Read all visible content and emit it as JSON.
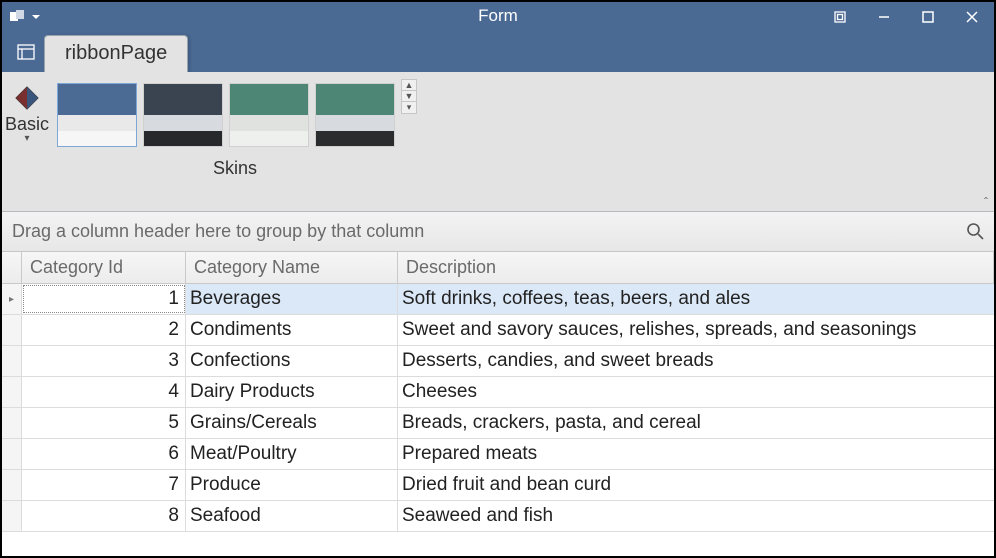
{
  "window": {
    "title": "Form"
  },
  "ribbon": {
    "tab_label": "ribbonPage",
    "basic_label": "Basic",
    "skins_label": "Skins",
    "swatches": [
      {
        "bands": [
          "#4b6b95",
          "#4b6b95",
          "#e9e9e9",
          "#f6f6f6"
        ],
        "selected": true
      },
      {
        "bands": [
          "#3a4350",
          "#3a4350",
          "#d7dadf",
          "#26282b"
        ],
        "selected": false
      },
      {
        "bands": [
          "#4e8675",
          "#4e8675",
          "#dfe2df",
          "#eef0ee"
        ],
        "selected": false
      },
      {
        "bands": [
          "#4e8675",
          "#4e8675",
          "#d7dadf",
          "#2a2c2e"
        ],
        "selected": false
      }
    ]
  },
  "group_panel": {
    "hint": "Drag a column header here to group by that column"
  },
  "grid": {
    "columns": {
      "id": "Category Id",
      "name": "Category Name",
      "desc": "Description"
    },
    "rows": [
      {
        "id": "1",
        "name": "Beverages",
        "desc": "Soft drinks, coffees, teas, beers, and ales",
        "focused": true
      },
      {
        "id": "2",
        "name": "Condiments",
        "desc": "Sweet and savory sauces, relishes, spreads, and seasonings"
      },
      {
        "id": "3",
        "name": "Confections",
        "desc": "Desserts, candies, and sweet breads"
      },
      {
        "id": "4",
        "name": "Dairy Products",
        "desc": "Cheeses"
      },
      {
        "id": "5",
        "name": "Grains/Cereals",
        "desc": "Breads, crackers, pasta, and cereal"
      },
      {
        "id": "6",
        "name": "Meat/Poultry",
        "desc": "Prepared meats"
      },
      {
        "id": "7",
        "name": "Produce",
        "desc": "Dried fruit and bean curd"
      },
      {
        "id": "8",
        "name": "Seafood",
        "desc": "Seaweed and fish"
      }
    ]
  }
}
